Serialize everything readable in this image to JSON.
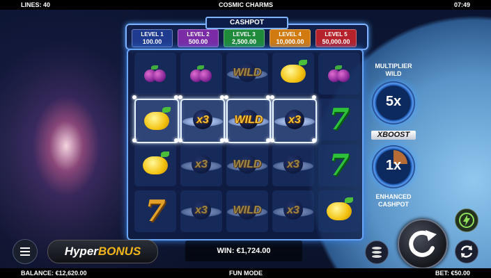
{
  "top_bar": {
    "lines": "LINES: 40",
    "title": "COSMIC CHARMS",
    "time": "07:49"
  },
  "cashpot": {
    "title": "CASHPOT",
    "levels": [
      {
        "label": "LEVEL 1",
        "amount": "100.00",
        "color": "#1f3b8f"
      },
      {
        "label": "LEVEL 2",
        "amount": "500.00",
        "color": "#7a2ba5"
      },
      {
        "label": "LEVEL 3",
        "amount": "2,500.00",
        "color": "#1f8a3a"
      },
      {
        "label": "LEVEL 4",
        "amount": "10,000.00",
        "color": "#d07a10"
      },
      {
        "label": "LEVEL 5",
        "amount": "50,000.00",
        "color": "#b5222b"
      }
    ]
  },
  "reels": {
    "rows": [
      [
        "plum",
        "plum",
        "wild-orb",
        "lemon",
        "plum"
      ],
      [
        "lemon",
        "x3-orb",
        "wild-orb",
        "x3-orb",
        "seven-green"
      ],
      [
        "lemon",
        "x3-orb",
        "wild-orb",
        "x3-orb",
        "seven-green"
      ],
      [
        "seven-orange",
        "x3-orb",
        "wild-orb",
        "x3-orb",
        "lemon"
      ]
    ],
    "highlighted_row": 2,
    "highlighted_columns": [
      1,
      2,
      3,
      4
    ],
    "orb_texts": {
      "wild": "WILD",
      "x3": "x3"
    }
  },
  "multiplier_wild": {
    "label_1": "MULTIPLIER",
    "label_2": "WILD",
    "value": "5x"
  },
  "boost": {
    "label": "BOOST",
    "prefix": "X"
  },
  "enhanced_cashpot": {
    "value": "1x",
    "label_1": "ENHANCED",
    "label_2": "CASHPOT"
  },
  "hyper_bonus": {
    "part1": "Hyper",
    "part2": "BONUS"
  },
  "win": "WIN: €1,724.00",
  "bottom_bar": {
    "balance": "BALANCE: €12,620.00",
    "mode": "FUN MODE",
    "bet": "BET: €50.00"
  },
  "icons": [
    "menu-icon",
    "coin-stack-icon",
    "spin-icon",
    "autoplay-bolt-icon",
    "refresh-icon"
  ]
}
